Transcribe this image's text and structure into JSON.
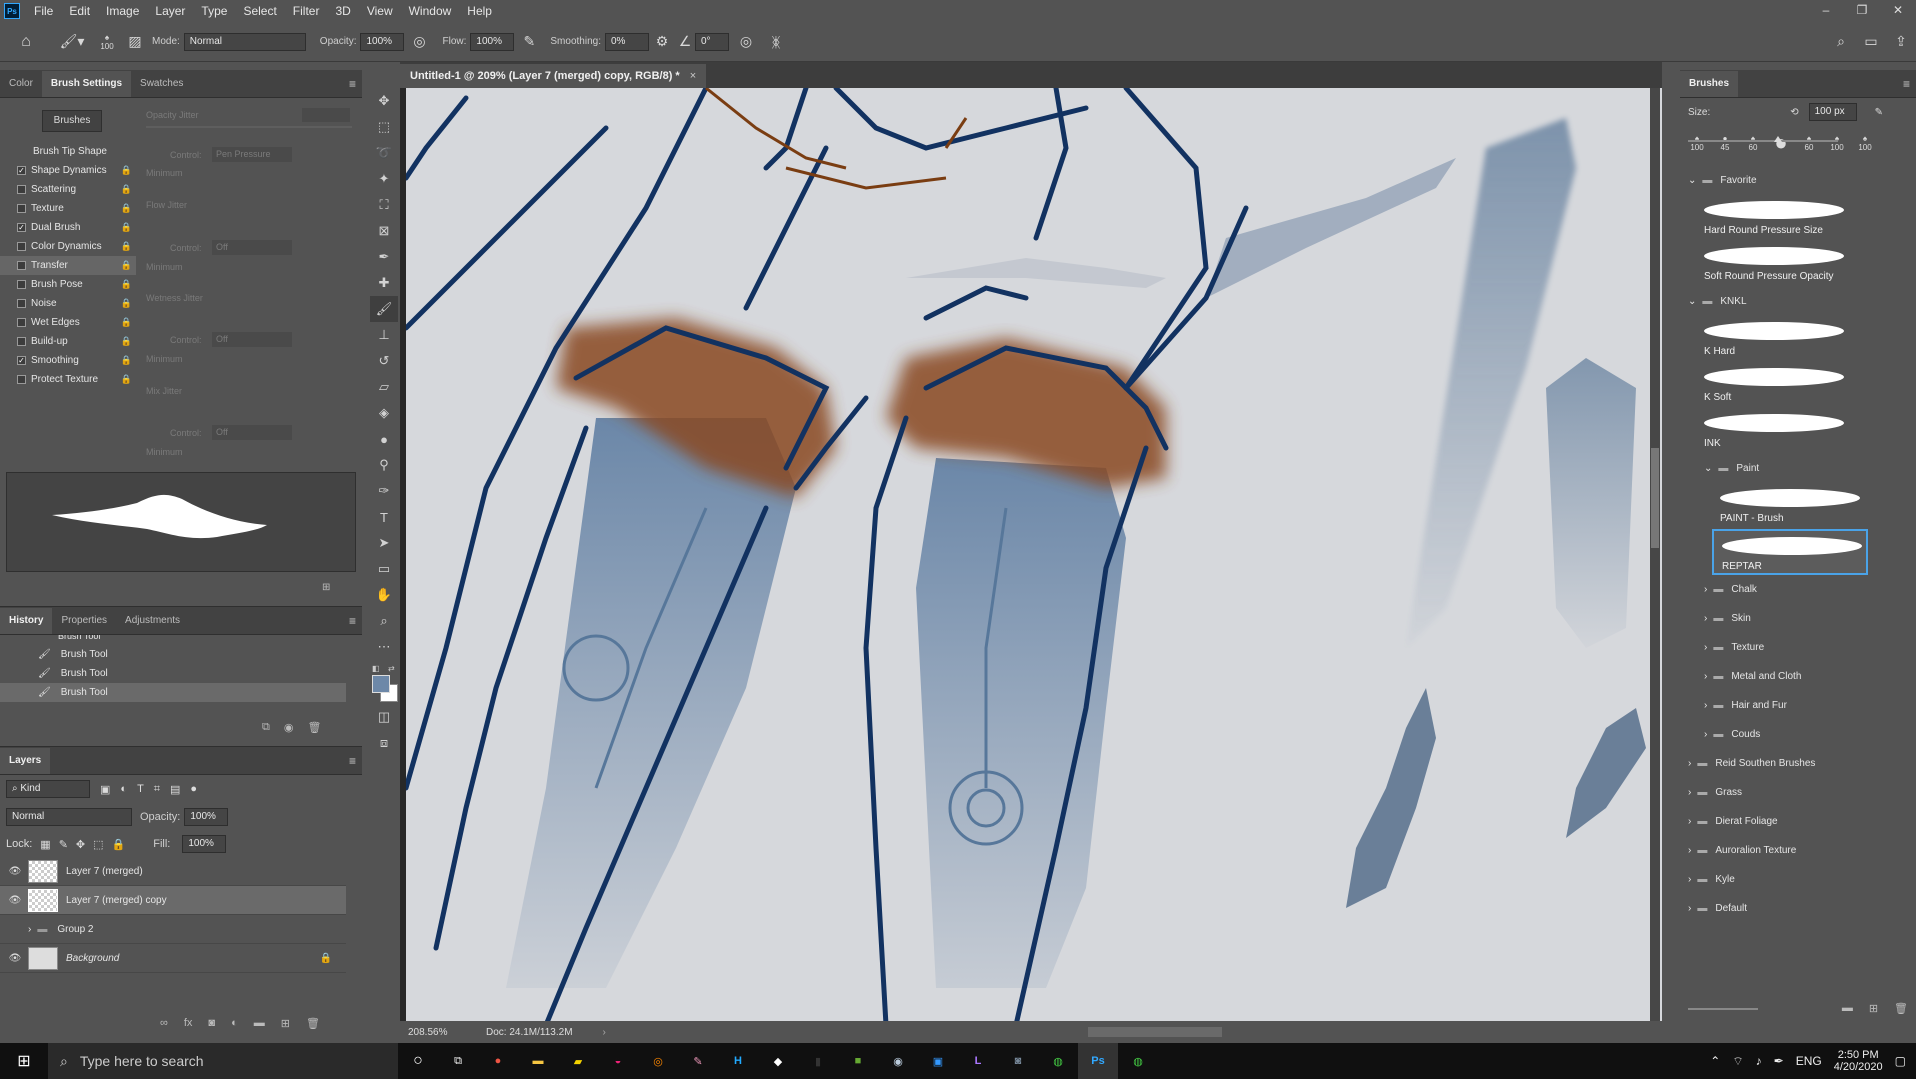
{
  "app": {
    "logo": "Ps"
  },
  "menu": [
    "File",
    "Edit",
    "Image",
    "Layer",
    "Type",
    "Select",
    "Filter",
    "3D",
    "View",
    "Window",
    "Help"
  ],
  "options": {
    "brush_size": "100",
    "mode_label": "Mode:",
    "mode": "Normal",
    "opacity_label": "Opacity:",
    "opacity": "100%",
    "flow_label": "Flow:",
    "flow": "100%",
    "smoothing_label": "Smoothing:",
    "smoothing": "0%",
    "angle": "0°"
  },
  "left_tabs": [
    "Color",
    "Brush Settings",
    "Swatches"
  ],
  "brush_settings": {
    "brushes_button": "Brushes",
    "items": [
      {
        "label": "Brush Tip Shape",
        "check": null
      },
      {
        "label": "Shape Dynamics",
        "check": true
      },
      {
        "label": "Scattering",
        "check": false
      },
      {
        "label": "Texture",
        "check": false
      },
      {
        "label": "Dual Brush",
        "check": true
      },
      {
        "label": "Color Dynamics",
        "check": false
      },
      {
        "label": "Transfer",
        "check": false
      },
      {
        "label": "Brush Pose",
        "check": false
      },
      {
        "label": "Noise",
        "check": false
      },
      {
        "label": "Wet Edges",
        "check": false
      },
      {
        "label": "Build-up",
        "check": false
      },
      {
        "label": "Smoothing",
        "check": true
      },
      {
        "label": "Protect Texture",
        "check": false
      }
    ],
    "right": {
      "opacity_jitter": "Opacity Jitter",
      "control": "Control:",
      "pen_pressure": "Pen Pressure",
      "minimum": "Minimum",
      "flow_jitter": "Flow Jitter",
      "off": "Off",
      "wetness_jitter": "Wetness Jitter",
      "mix_jitter": "Mix Jitter"
    }
  },
  "history_tabs": [
    "History",
    "Properties",
    "Adjustments"
  ],
  "history": [
    "Brush Tool",
    "Brush Tool",
    "Brush Tool",
    "Brush Tool"
  ],
  "layers": {
    "title": "Layers",
    "kind": "Kind",
    "blend": "Normal",
    "opacity_label": "Opacity:",
    "opacity": "100%",
    "lock_label": "Lock:",
    "fill_label": "Fill:",
    "fill": "100%",
    "rows": [
      "Layer 7 (merged)",
      "Layer 7 (merged) copy",
      "Group 2",
      "Background"
    ]
  },
  "document": {
    "tab": "Untitled-1 @ 209% (Layer 7 (merged) copy, RGB/8) *",
    "zoom": "208.56%",
    "doc_size": "Doc: 24.1M/113.2M"
  },
  "brushes_panel": {
    "title": "Brushes",
    "size_label": "Size:",
    "size": "100 px",
    "presets": [
      "100",
      "45",
      "60",
      "",
      "60",
      "100",
      "100"
    ],
    "groups": [
      {
        "name": "Favorite",
        "items": [
          "Hard Round Pressure Size",
          "Soft Round Pressure Opacity"
        ]
      },
      {
        "name": "KNKL",
        "items": [
          "K Hard",
          "K Soft",
          "INK"
        ]
      },
      {
        "name": "Paint",
        "items": [
          "PAINT - Brush",
          "REPTAR"
        ]
      }
    ],
    "subfolders": [
      "Chalk",
      "Skin",
      "Texture",
      "Metal and Cloth",
      "Hair and Fur",
      "Couds"
    ],
    "folders": [
      "Reid Southen Brushes",
      "Grass",
      "Dierat Foliage",
      "Auroralion Texture",
      "Kyle",
      "Default"
    ]
  },
  "taskbar": {
    "search": "Type here to search",
    "lang": "ENG",
    "time": "2:50 PM",
    "date": "4/20/2020"
  },
  "colors": {
    "fg": "#6d88a8",
    "bg": "#ffffff",
    "accent": "#31a8ff"
  }
}
